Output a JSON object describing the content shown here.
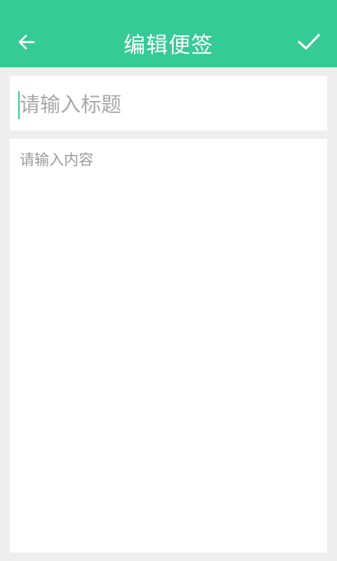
{
  "toolbar": {
    "title": "编辑便签",
    "back_icon": "arrow-left-icon",
    "confirm_icon": "check-icon",
    "background_color": "#34cb94",
    "icon_color": "#ffffff"
  },
  "form": {
    "title_placeholder": "请输入标题",
    "title_value": "",
    "content_placeholder": "请输入内容",
    "content_value": ""
  },
  "colors": {
    "page_background": "#eeeeee",
    "card_background": "#ffffff",
    "accent": "#34cb94",
    "placeholder": "#a8a8a8"
  }
}
